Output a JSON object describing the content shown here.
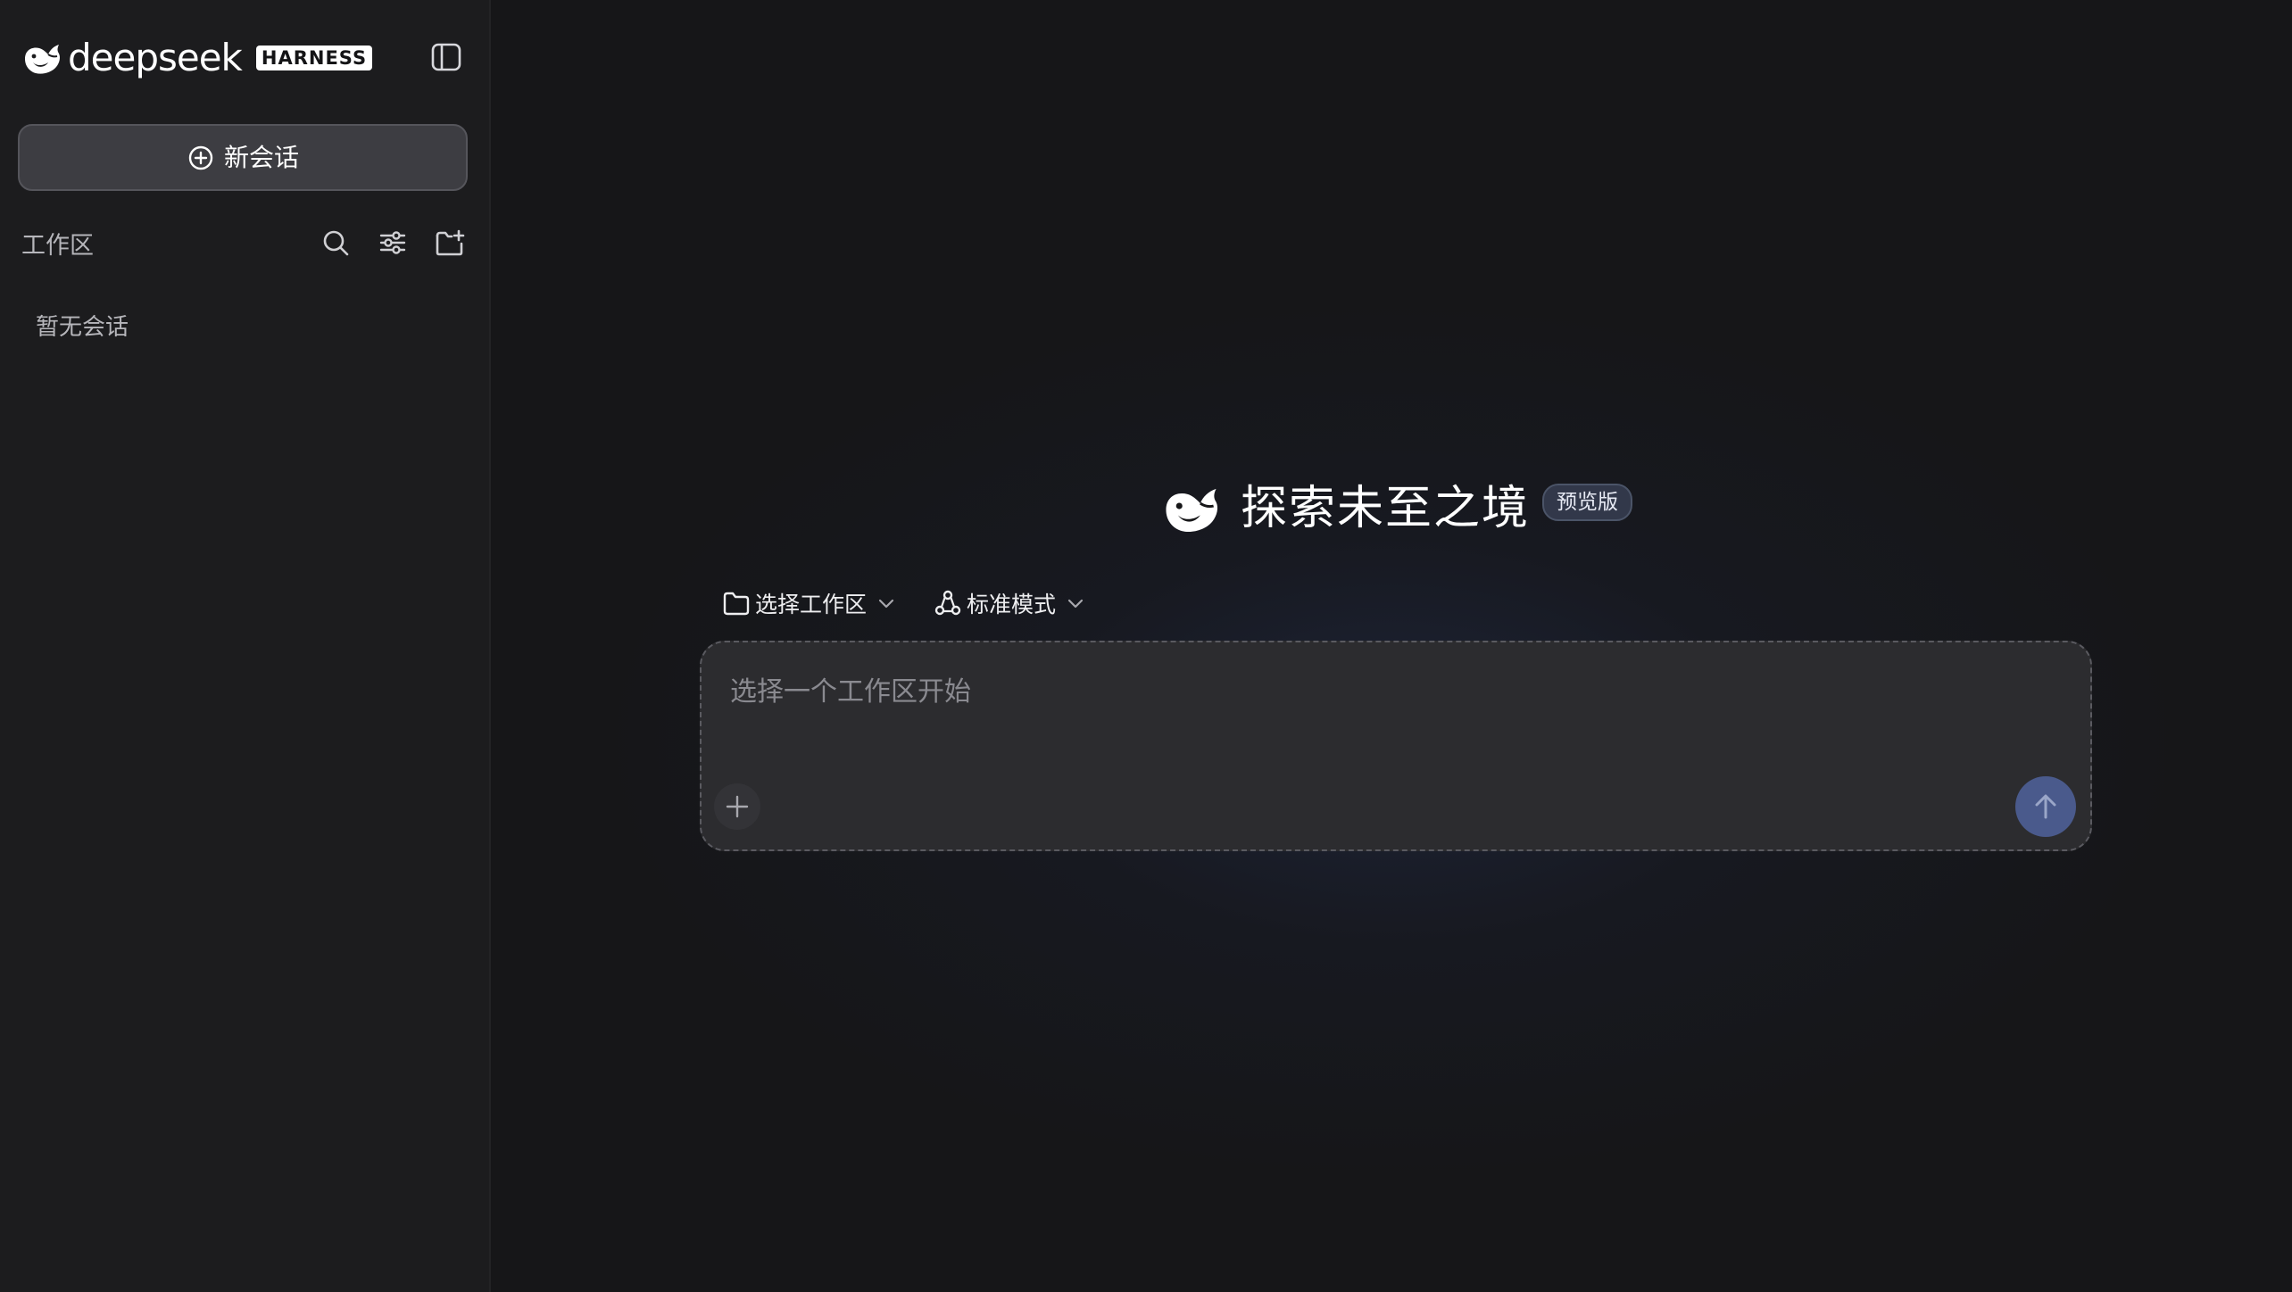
{
  "colors": {
    "sidebar_bg": "#1c1c1e",
    "main_bg": "#161618",
    "new_chat_bg": "#3d3d42",
    "composer_bg": "#2c2c2f",
    "send_button": "#4a5a8c",
    "badge_bg": "#32384a"
  },
  "sidebar": {
    "brand_name": "deepseek",
    "brand_badge": "HARNESS",
    "logo_icon": "whale-logo-icon",
    "toggle_icon": "sidebar-toggle-icon",
    "new_chat_label": "新会话",
    "new_chat_icon": "plus-circle-icon",
    "workspace_label": "工作区",
    "workspace_icons": [
      "search-icon",
      "filter-settings-icon",
      "new-folder-icon"
    ],
    "empty_label": "暂无会话"
  },
  "main": {
    "hero_icon": "whale-logo-icon",
    "hero_title": "探索未至之境",
    "hero_badge": "预览版",
    "workspace_select": {
      "icon": "folder-icon",
      "label": "选择工作区"
    },
    "mode_select": {
      "icon": "mode-nodes-icon",
      "label": "标准模式"
    },
    "composer": {
      "placeholder": "选择一个工作区开始",
      "value": "",
      "attach_icon": "plus-icon",
      "send_icon": "arrow-up-icon"
    }
  }
}
